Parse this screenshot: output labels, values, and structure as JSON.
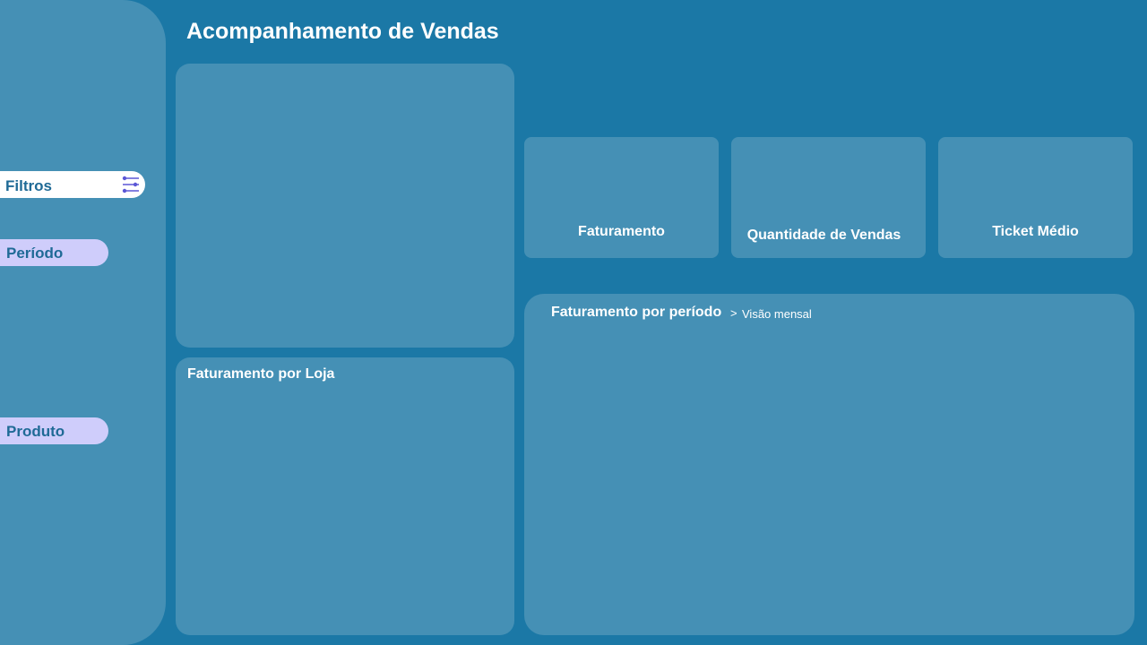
{
  "header": {
    "title": "Acompanhamento de Vendas"
  },
  "sidebar": {
    "filters_label": "Filtros",
    "filters_icon": "sliders-icon",
    "sections": [
      {
        "label": "Período"
      },
      {
        "label": "Produto"
      }
    ]
  },
  "kpis": [
    {
      "label": "Faturamento"
    },
    {
      "label": "Quantidade de Vendas"
    },
    {
      "label": "Ticket Médio"
    }
  ],
  "panels": {
    "store_revenue": {
      "title": "Faturamento por Loja"
    },
    "period_revenue": {
      "title": "Faturamento por período",
      "separator": ">",
      "subtitle": "Visão mensal"
    }
  },
  "colors": {
    "background": "#1b78a6",
    "card": "#4590b5",
    "pill_active": "#ffffff",
    "pill_section": "#cfcdfb",
    "text_accent": "#1f6a96",
    "icon": "#5b57d6"
  }
}
